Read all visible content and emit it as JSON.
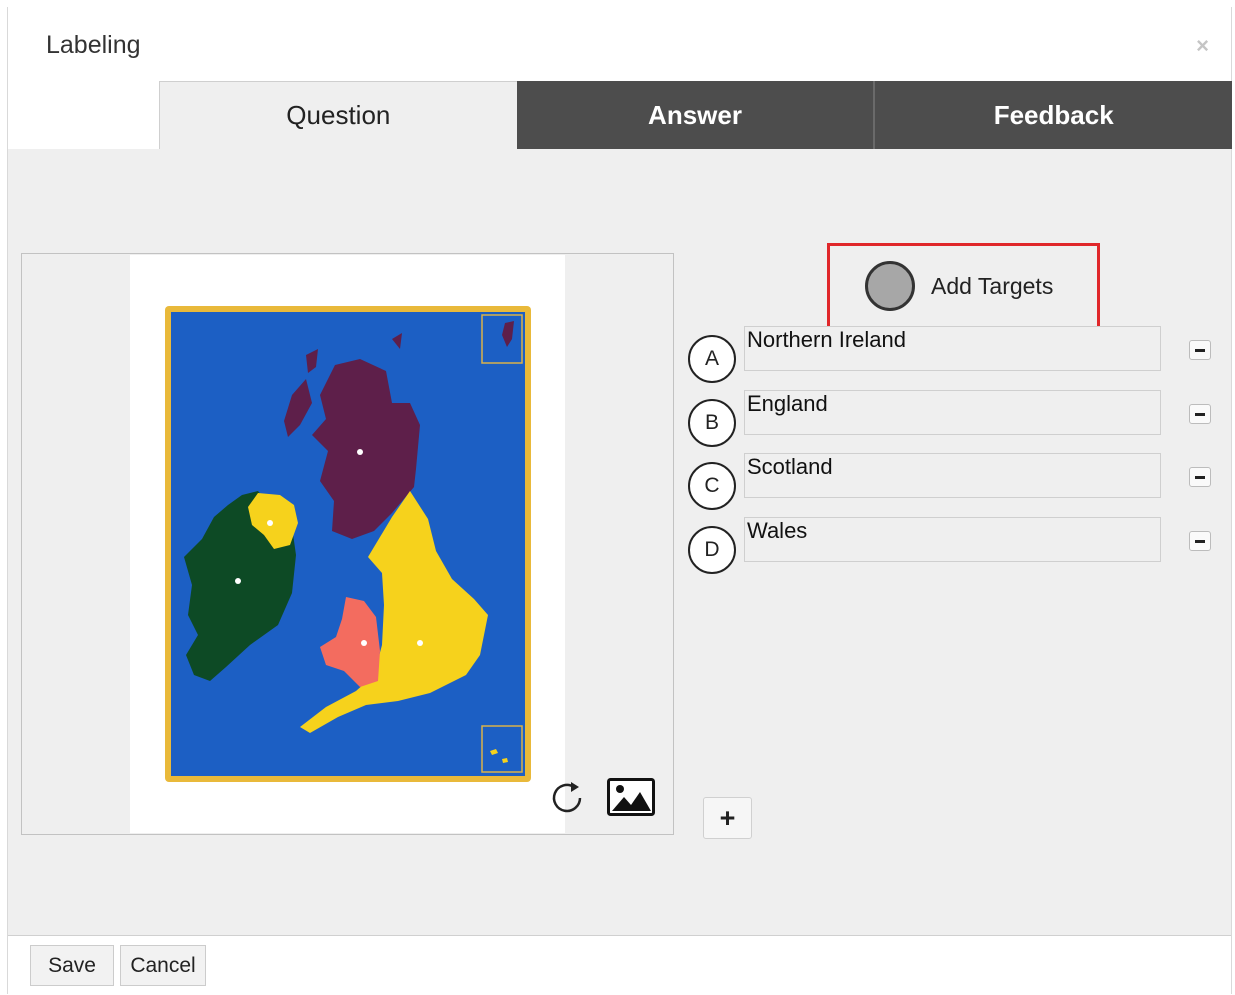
{
  "dialog": {
    "title": "Labeling"
  },
  "tabs": [
    {
      "label": "Question",
      "active": true
    },
    {
      "label": "Answer",
      "active": false
    },
    {
      "label": "Feedback",
      "active": false
    }
  ],
  "add_targets": {
    "label": "Add Targets"
  },
  "targets": [
    {
      "letter": "A",
      "value": "Northern Ireland"
    },
    {
      "letter": "B",
      "value": "England"
    },
    {
      "letter": "C",
      "value": "Scotland"
    },
    {
      "letter": "D",
      "value": "Wales"
    }
  ],
  "footer": {
    "save_label": "Save",
    "cancel_label": "Cancel"
  },
  "icons": {
    "close": "close-icon",
    "rotate": "rotate-icon",
    "image": "image-icon",
    "add": "plus-icon",
    "remove": "minus-icon"
  },
  "colors": {
    "highlight_border": "#e0272a",
    "tab_dark": "#4d4d4d",
    "map_sea": "#1c5fc4",
    "map_frame": "#e9b93a",
    "ireland": "#0d4a25",
    "scotland": "#5e1f4a",
    "england": "#f6d21c",
    "wales": "#f36c5f"
  }
}
